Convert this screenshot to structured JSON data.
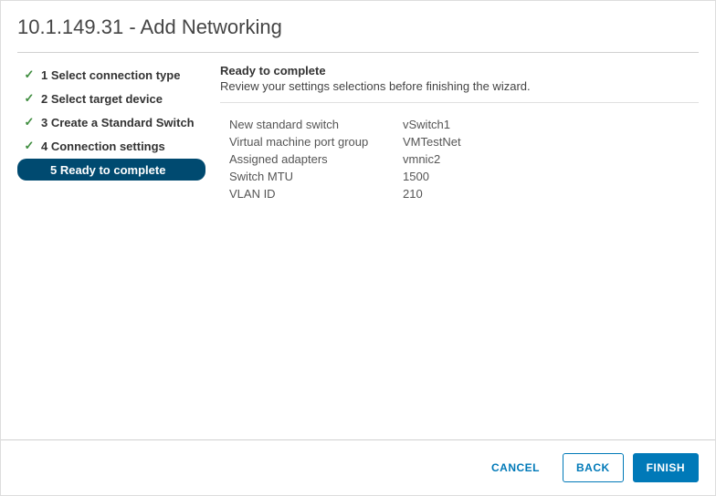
{
  "title": "10.1.149.31 - Add Networking",
  "steps": [
    {
      "label": "1 Select connection type"
    },
    {
      "label": "2 Select target device"
    },
    {
      "label": "3 Create a Standard Switch"
    },
    {
      "label": "4 Connection settings"
    },
    {
      "label": "5 Ready to complete"
    }
  ],
  "section": {
    "title": "Ready to complete",
    "desc": "Review your settings selections before finishing the wizard."
  },
  "summary": {
    "new_switch_label": "New standard switch",
    "new_switch_value": "vSwitch1",
    "port_group_label": "Virtual machine port group",
    "port_group_value": "VMTestNet",
    "adapters_label": "Assigned adapters",
    "adapters_value": "vmnic2",
    "mtu_label": "Switch MTU",
    "mtu_value": "1500",
    "vlan_label": "VLAN ID",
    "vlan_value": "210"
  },
  "buttons": {
    "cancel": "CANCEL",
    "back": "BACK",
    "finish": "FINISH"
  }
}
